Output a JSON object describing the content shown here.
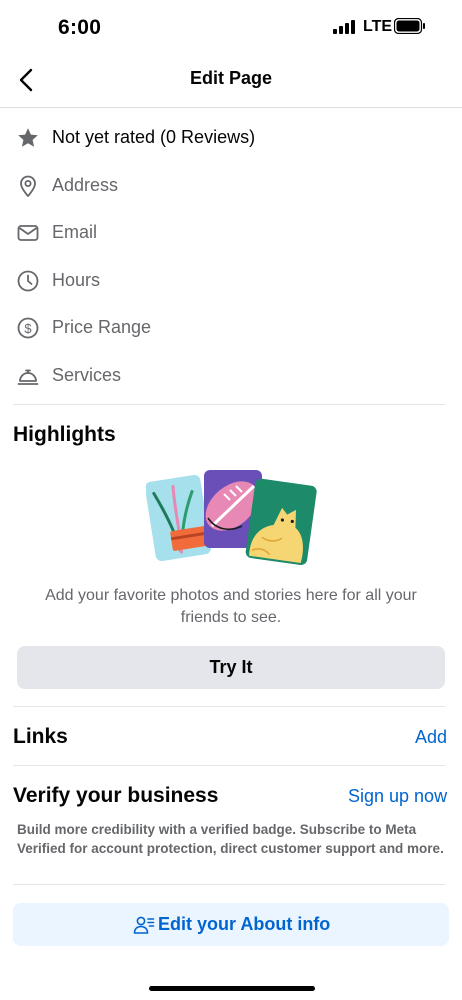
{
  "status_bar": {
    "time": "6:00",
    "network": "LTE"
  },
  "nav": {
    "title": "Edit Page"
  },
  "info_rows": [
    {
      "label": "Not yet rated (0 Reviews)",
      "icon": "star-icon"
    },
    {
      "label": "Address",
      "icon": "location-pin-icon"
    },
    {
      "label": "Email",
      "icon": "envelope-icon"
    },
    {
      "label": "Hours",
      "icon": "clock-icon"
    },
    {
      "label": "Price Range",
      "icon": "dollar-circle-icon"
    },
    {
      "label": "Services",
      "icon": "service-bell-icon"
    }
  ],
  "highlights": {
    "title": "Highlights",
    "description": "Add your favorite photos and stories here for all your friends to see.",
    "button_label": "Try It"
  },
  "links": {
    "title": "Links",
    "action_label": "Add"
  },
  "verify": {
    "title": "Verify your business",
    "action_label": "Sign up now",
    "description": "Build more credibility with a verified badge. Subscribe to Meta Verified for account protection, direct customer support and more."
  },
  "about_button": {
    "label": "Edit your About info",
    "icon": "person-list-icon"
  },
  "colors": {
    "accent": "#0064d1",
    "text_primary": "#050505",
    "text_secondary": "#65676b",
    "button_bg": "#e4e6eb",
    "about_bg": "#ebf5ff"
  }
}
